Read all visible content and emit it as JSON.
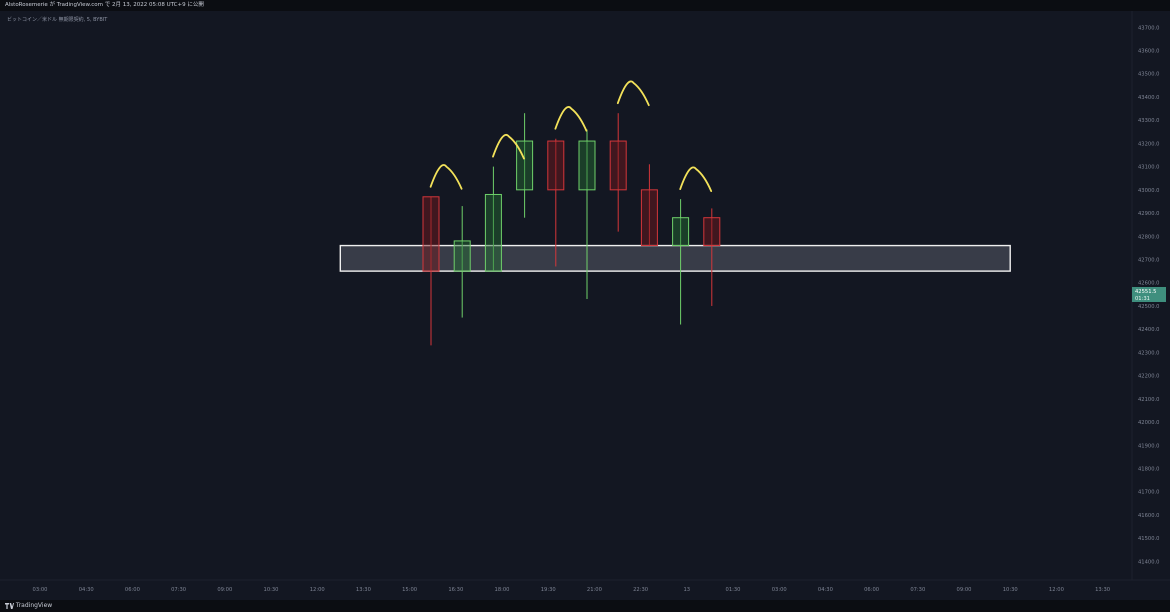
{
  "header": {
    "published_text": "AlstoRosemerie が TradingView.com で 2月 13, 2022 05:08 UTC+9 に公開"
  },
  "legend_text": "ビットコイン／米ドル 無期限契約, 5, BYBIT",
  "footer": {
    "brand": "TradingView",
    "logo": "tradingview-logo-icon"
  },
  "colors": {
    "background": "#131722",
    "up": "#6fd06a",
    "down": "#d4363a",
    "up_fill": "rgba(38,110,50,0.45)",
    "down_fill": "rgba(120,24,28,0.45)",
    "zone_border": "#f0f0f0",
    "zone_fill": "rgba(190,195,210,0.22)",
    "arc": "#f3e25a",
    "axis_text": "#7e8494",
    "price_tag": "#3f8f7e"
  },
  "chart_data": {
    "type": "candlestick",
    "title": "ビットコイン／米ドル 無期限契約, 5, BYBIT",
    "y_axis": {
      "ylim": [
        41320,
        43770
      ],
      "ticks": [
        41400,
        41500,
        41600,
        41700,
        41800,
        41900,
        42000,
        42100,
        42200,
        42300,
        42400,
        42500,
        42600,
        42700,
        42800,
        42900,
        43000,
        43100,
        43200,
        43300,
        43400,
        43500,
        43600,
        43700
      ],
      "tick_labels": [
        "41400.0",
        "41500.0",
        "41600.0",
        "41700.0",
        "41800.0",
        "41900.0",
        "42000.0",
        "42100.0",
        "42200.0",
        "42300.0",
        "42400.0",
        "42500.0",
        "42600.0",
        "42700.0",
        "42800.0",
        "42900.0",
        "43000.0",
        "43100.0",
        "43200.0",
        "43300.0",
        "43400.0",
        "43500.0",
        "43600.0",
        "43700.0"
      ]
    },
    "x_axis": {
      "labels": [
        "03:00",
        "04:30",
        "06:00",
        "07:30",
        "09:00",
        "10:30",
        "12:00",
        "13:30",
        "15:00",
        "16:30",
        "18:00",
        "19:30",
        "21:00",
        "22:30",
        "13",
        "01:30",
        "03:00",
        "04:30",
        "06:00",
        "07:30",
        "09:00",
        "10:30",
        "12:00",
        "13:30"
      ]
    },
    "candles": [
      {
        "open": 42970,
        "high": 42970,
        "low": 42330,
        "close": 42650
      },
      {
        "open": 42650,
        "high": 42930,
        "low": 42450,
        "close": 42780
      },
      {
        "open": 42650,
        "high": 43100,
        "low": 42650,
        "close": 42980
      },
      {
        "open": 43000,
        "high": 43330,
        "low": 42880,
        "close": 43210
      },
      {
        "open": 43210,
        "high": 43220,
        "low": 42670,
        "close": 43000
      },
      {
        "open": 43000,
        "high": 43260,
        "low": 42530,
        "close": 43210
      },
      {
        "open": 43210,
        "high": 43330,
        "low": 42820,
        "close": 43000
      },
      {
        "open": 43000,
        "high": 43110,
        "low": 42760,
        "close": 42760
      },
      {
        "open": 42760,
        "high": 42960,
        "low": 42420,
        "close": 42880
      },
      {
        "open": 42880,
        "high": 42920,
        "low": 42500,
        "close": 42760
      }
    ],
    "current_price": {
      "label": "42551.5",
      "countdown": "01:31",
      "value": 42551.5
    },
    "zone": {
      "low": 42650,
      "high": 42760,
      "start_label": "12:00",
      "end_label": "10:30"
    },
    "annotations": [
      {
        "candle": 0,
        "note": "peak arc"
      },
      {
        "candle": 2,
        "note": "peak arc"
      },
      {
        "candle": 4,
        "note": "peak arc"
      },
      {
        "candle": 6,
        "note": "peak arc"
      },
      {
        "candle": 8,
        "note": "peak arc"
      }
    ]
  }
}
